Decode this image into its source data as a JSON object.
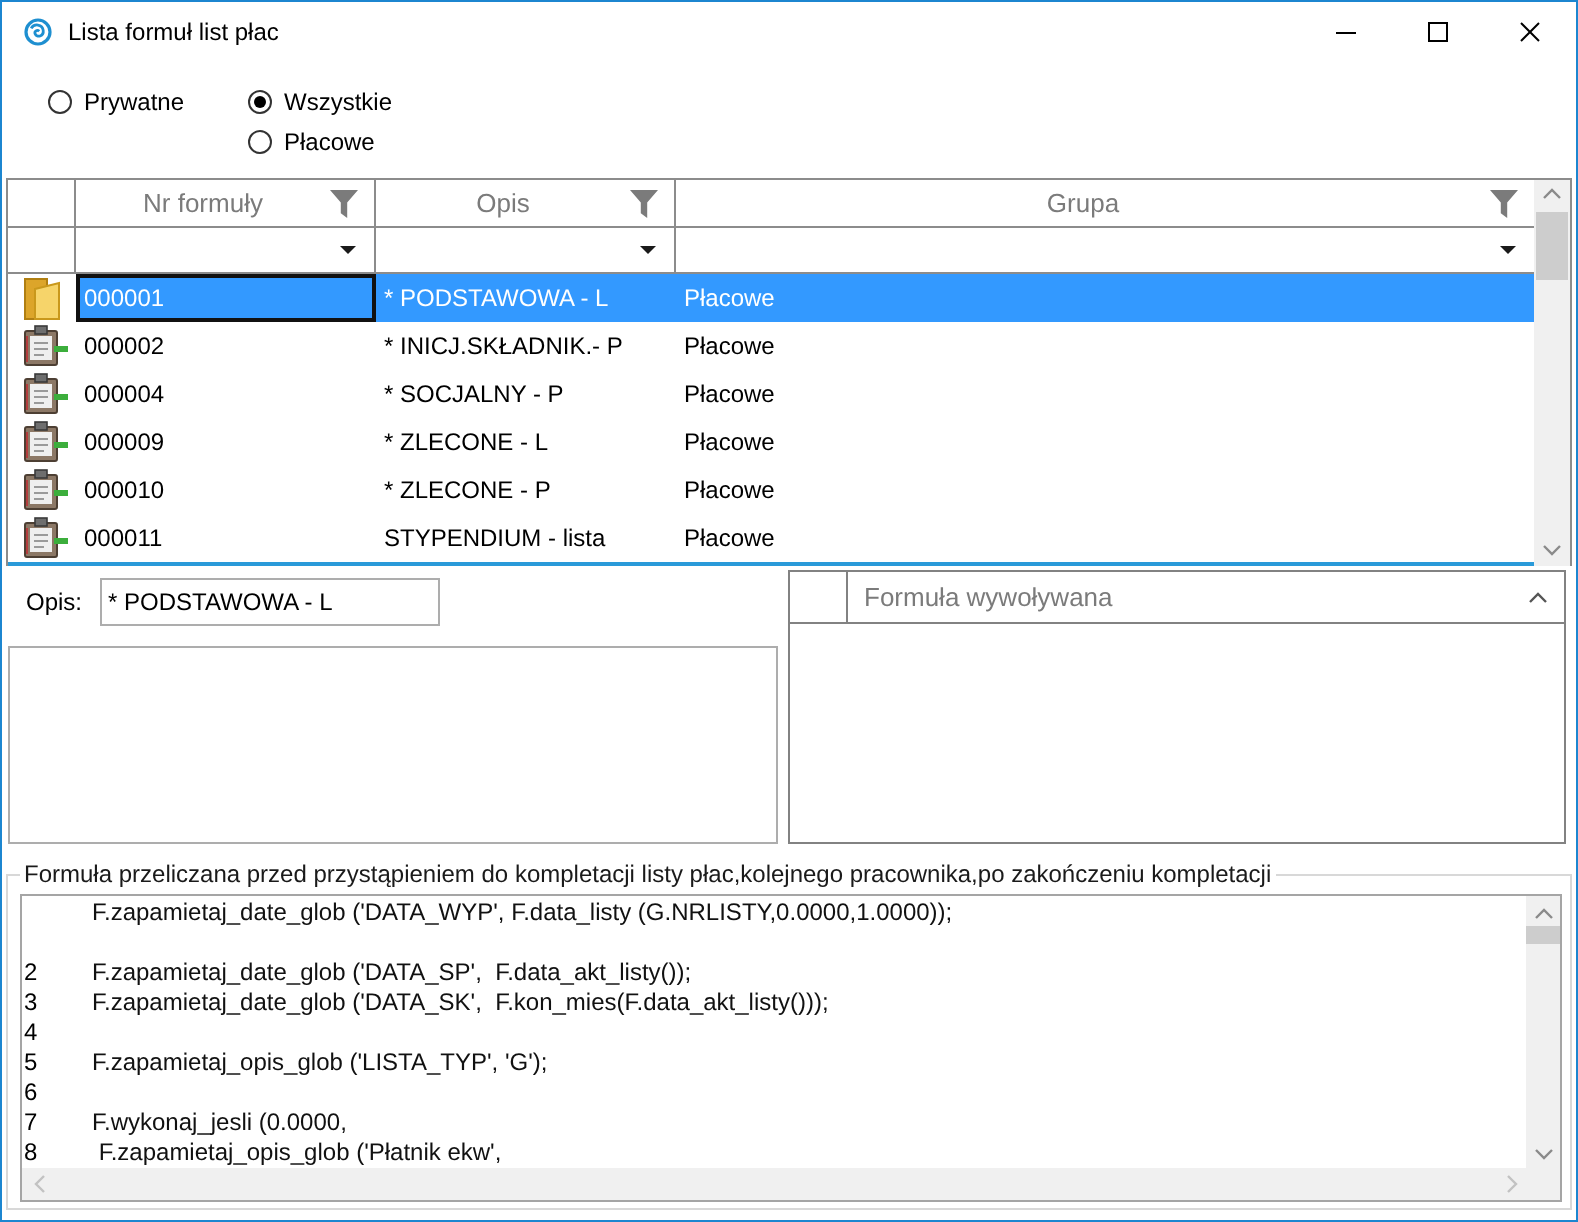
{
  "window": {
    "title": "Lista formuł list płac"
  },
  "filter_options": [
    {
      "label": "Prywatne",
      "selected": false
    },
    {
      "label": "Wszystkie",
      "selected": true
    },
    {
      "label": "Płacowe",
      "selected": false
    }
  ],
  "formula_table": {
    "columns": [
      {
        "label": "Nr formuły"
      },
      {
        "label": "Opis"
      },
      {
        "label": "Grupa"
      }
    ],
    "rows": [
      {
        "kind": "folder",
        "selected": true,
        "cells": [
          "000001",
          "* PODSTAWOWA - L",
          "Płacowe"
        ]
      },
      {
        "kind": "formula",
        "selected": false,
        "cells": [
          "000002",
          "* INICJ.SKŁADNIK.- P",
          "Płacowe"
        ]
      },
      {
        "kind": "formula",
        "selected": false,
        "cells": [
          "000004",
          "* SOCJALNY - P",
          "Płacowe"
        ]
      },
      {
        "kind": "formula",
        "selected": false,
        "cells": [
          "000009",
          "* ZLECONE - L",
          "Płacowe"
        ]
      },
      {
        "kind": "formula",
        "selected": false,
        "cells": [
          "000010",
          "* ZLECONE - P",
          "Płacowe"
        ]
      },
      {
        "kind": "formula",
        "selected": false,
        "cells": [
          "000011",
          "STYPENDIUM - lista",
          "Płacowe"
        ]
      }
    ]
  },
  "description": {
    "label": "Opis:",
    "value": "* PODSTAWOWA - L"
  },
  "called_formulas": {
    "columns": [
      {
        "label": "Formuła wywoływana",
        "sorted": true
      }
    ]
  },
  "formula_editor": {
    "title": "Formuła przeliczana przed przystąpieniem do kompletacji listy płac,kolejnego pracownika,po zakończeniu kompletacji",
    "lines": [
      {
        "kind": "code",
        "text": "F.zapamietaj_date_glob ('DATA_WYP', F.data_listy (G.NRLISTY,0.0000,1.0000));"
      },
      {
        "kind": "blank"
      },
      {
        "kind": "code",
        "number": "2",
        "text": "F.zapamietaj_date_glob ('DATA_SP',  F.data_akt_listy());"
      },
      {
        "kind": "code",
        "number": "3",
        "text": "F.zapamietaj_date_glob ('DATA_SK',  F.kon_mies(F.data_akt_listy()));"
      },
      {
        "kind": "code",
        "number": "4"
      },
      {
        "kind": "code",
        "number": "5",
        "text": "F.zapamietaj_opis_glob ('LISTA_TYP', 'G');"
      },
      {
        "kind": "code",
        "number": "6"
      },
      {
        "kind": "code",
        "number": "7",
        "text": "F.wykonaj_jesli (0.0000,"
      },
      {
        "kind": "code",
        "number": "8",
        "text": " F.zapamietaj_opis_glob ('Płatnik ekw',"
      }
    ]
  }
}
